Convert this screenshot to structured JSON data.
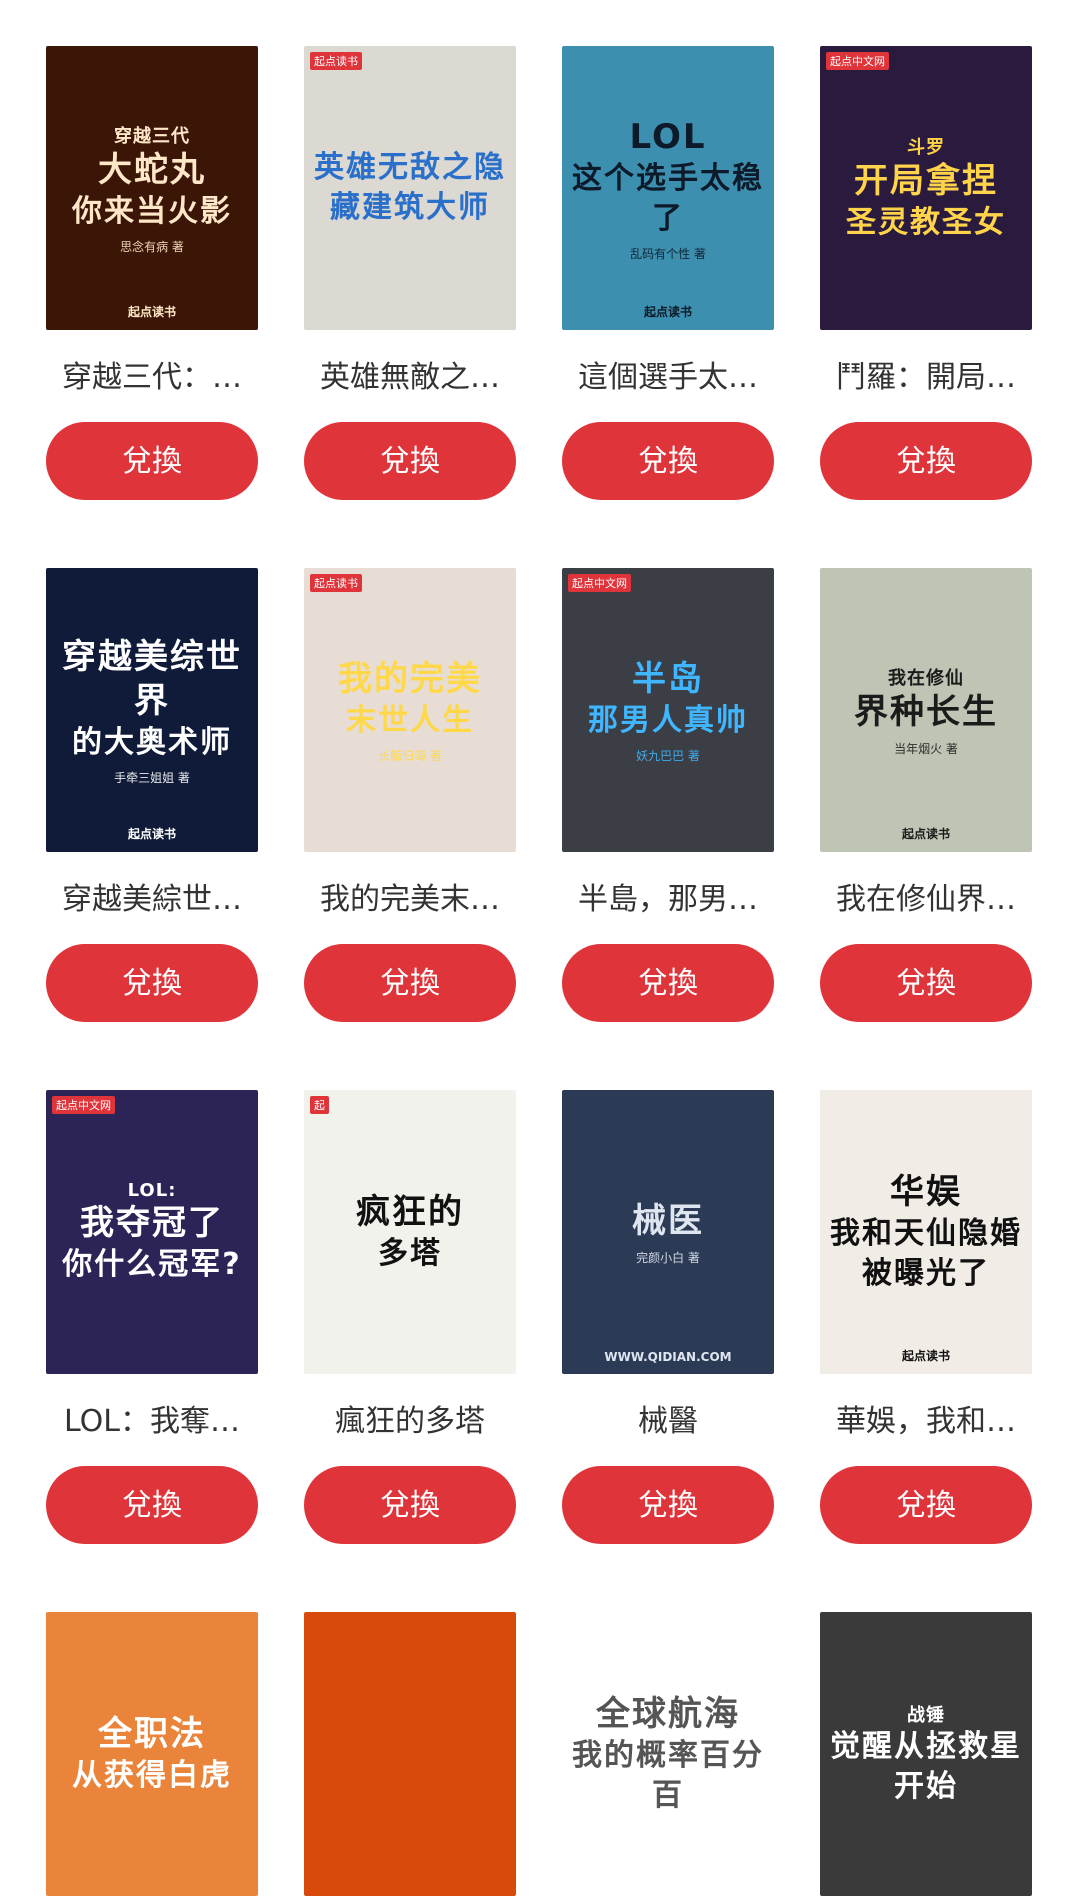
{
  "books": [
    {
      "title": "穿越三代：大蛇丸你來當火影",
      "display": "穿越三代：…",
      "button": "兌換",
      "cover": {
        "line1": "穿越三代",
        "line2": "大蛇丸",
        "line3": "你来当火影",
        "author": "思念有病 著",
        "publisher": "起点读书",
        "badge": "",
        "bg": "#3b1606",
        "fg": "#ffe7c8"
      }
    },
    {
      "title": "英雄無敵之隱藏建築大師",
      "display": "英雄無敵之…",
      "button": "兌換",
      "cover": {
        "line1": "",
        "line2": "",
        "line3": "英雄无敌之隐藏建筑大师",
        "author": "",
        "publisher": "",
        "badge": "起点读书",
        "bg": "#dcd8d2",
        "fg": "#2a6fc9"
      }
    },
    {
      "title": "這個選手太穩了",
      "display": "這個選手太…",
      "button": "兌換",
      "cover": {
        "line1": "",
        "line2": "LOL",
        "line3": "这个选手太稳了",
        "author": "乱码有个性 著",
        "publisher": "起点读书",
        "badge": "",
        "bg": "#3c8fae",
        "fg": "#0d1a2a"
      }
    },
    {
      "title": "鬥羅：開局拿捏聖靈教聖女",
      "display": "鬥羅：開局…",
      "button": "兌換",
      "cover": {
        "line1": "斗罗",
        "line2": "开局拿捏",
        "line3": "圣灵教圣女",
        "author": "",
        "publisher": "",
        "badge": "起点中文网",
        "bg": "#2a1a3e",
        "fg": "#ffd34a"
      }
    },
    {
      "title": "穿越美綜世界的大奧術師",
      "display": "穿越美綜世…",
      "button": "兌換",
      "cover": {
        "line1": "",
        "line2": "穿越美综世界",
        "line3": "的大奥术师",
        "author": "手牵三姐姐 著",
        "publisher": "起点读书",
        "badge": "",
        "bg": "#0f1b38",
        "fg": "#ffffff"
      }
    },
    {
      "title": "我的完美末世人生",
      "display": "我的完美末…",
      "button": "兌換",
      "cover": {
        "line1": "",
        "line2": "我的完美",
        "line3": "末世人生",
        "author": "长鲸归海 著",
        "publisher": "",
        "badge": "起点读书",
        "bg": "#e7ddd4",
        "fg": "#ffd84a"
      }
    },
    {
      "title": "半島，那男人真帥",
      "display": "半島，那男…",
      "button": "兌換",
      "cover": {
        "line1": "",
        "line2": "半岛",
        "line3": "那男人真帅",
        "author": "妖九巴巴 著",
        "publisher": "",
        "badge": "起点中文网",
        "bg": "#3b3e45",
        "fg": "#3fb6ff"
      }
    },
    {
      "title": "我在修仙界種長生",
      "display": "我在修仙界…",
      "button": "兌換",
      "cover": {
        "line1": "我在修仙",
        "line2": "界种长生",
        "line3": "",
        "author": "当年烟火 著",
        "publisher": "起点读书",
        "badge": "",
        "bg": "#bfc5b4",
        "fg": "#1b1b1b"
      }
    },
    {
      "title": "LOL：我奪冠了你什麼冠軍？",
      "display": "LOL：我奪…",
      "button": "兌換",
      "cover": {
        "line1": "LOL:",
        "line2": "我夺冠了",
        "line3": "你什么冠军?",
        "author": "",
        "publisher": "",
        "badge": "起点中文网",
        "bg": "#2c2357",
        "fg": "#ffffff"
      }
    },
    {
      "title": "瘋狂的多塔",
      "display": "瘋狂的多塔",
      "button": "兌換",
      "cover": {
        "line1": "",
        "line2": "疯狂的",
        "line3": "多塔",
        "author": "",
        "publisher": "",
        "badge": "起",
        "bg": "#f2f2ec",
        "fg": "#111111"
      }
    },
    {
      "title": "械醫",
      "display": "械醫",
      "button": "兌換",
      "cover": {
        "line1": "",
        "line2": "械医",
        "line3": "",
        "author": "完颜小白 著",
        "publisher": "WWW.QIDIAN.COM",
        "badge": "",
        "bg": "#2b3a55",
        "fg": "#dfe6f0"
      }
    },
    {
      "title": "華娛，我和天仙隱婚被曝光了",
      "display": "華娛，我和…",
      "button": "兌換",
      "cover": {
        "line1": "",
        "line2": "华娱",
        "line3": "我和天仙隐婚被曝光了",
        "author": "",
        "publisher": "起点读书",
        "badge": "",
        "bg": "#f1ece6",
        "fg": "#111111"
      }
    },
    {
      "title": "從獲得白虎開始全職法師",
      "display": "",
      "button": "",
      "cover": {
        "line1": "",
        "line2": "全职法",
        "line3": "从获得白虎",
        "author": "",
        "publisher": "",
        "badge": "",
        "bg": "#e9843a",
        "fg": "#ffffff"
      }
    },
    {
      "title": "",
      "display": "",
      "button": "",
      "cover": {
        "line1": "",
        "line2": "",
        "line3": "",
        "author": "",
        "publisher": "",
        "badge": "",
        "bg": "#d84a0c",
        "fg": "#ffffff"
      }
    },
    {
      "title": "全球航海：我的概率百分百",
      "display": "",
      "button": "",
      "cover": {
        "line1": "",
        "line2": "全球航海",
        "line3": "我的概率百分百",
        "author": "",
        "publisher": "",
        "badge": "",
        "bg": "#ffffff",
        "fg": "#555555"
      }
    },
    {
      "title": "戰錘：覺醒從拯救星球開始",
      "display": "",
      "button": "",
      "cover": {
        "line1": "战锤",
        "line2": "",
        "line3": "觉醒从拯救星开始",
        "author": "",
        "publisher": "",
        "badge": "",
        "bg": "#3a3a3a",
        "fg": "#ffffff"
      }
    }
  ]
}
